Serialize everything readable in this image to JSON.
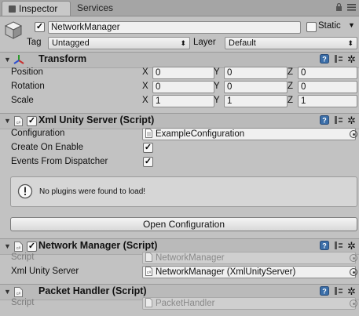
{
  "tabs": [
    {
      "label": "Inspector"
    },
    {
      "label": "Services"
    }
  ],
  "gameobject": {
    "name": "NetworkManager",
    "static_label": "Static",
    "tag_label": "Tag",
    "tag_value": "Untagged",
    "layer_label": "Layer",
    "layer_value": "Default"
  },
  "transform": {
    "title": "Transform",
    "rows": [
      {
        "label": "Position",
        "x": "0",
        "y": "0",
        "z": "0"
      },
      {
        "label": "Rotation",
        "x": "0",
        "y": "0",
        "z": "0"
      },
      {
        "label": "Scale",
        "x": "1",
        "y": "1",
        "z": "1"
      }
    ],
    "axis": {
      "x": "X",
      "y": "Y",
      "z": "Z"
    }
  },
  "xml_server": {
    "title": "Xml Unity Server (Script)",
    "configuration_label": "Configuration",
    "configuration_value": "ExampleConfiguration",
    "create_on_enable_label": "Create On Enable",
    "create_on_enable": true,
    "events_label": "Events From Dispatcher",
    "events_from_dispatcher": true,
    "help_message": "No plugins were found to load!",
    "open_button": "Open Configuration"
  },
  "network_manager": {
    "title": "Network Manager (Script)",
    "script_label": "Script",
    "script_value": "NetworkManager",
    "server_label": "Xml Unity Server",
    "server_value": "NetworkManager (XmlUnityServer)"
  },
  "packet_handler": {
    "title": "Packet Handler (Script)",
    "script_label": "Script",
    "script_value": "PacketHandler"
  },
  "icons": [
    "lock-icon",
    "menu-icon",
    "help-icon",
    "presets-icon",
    "gear-icon",
    "gameobject-cube-icon",
    "transform-axes-icon",
    "script-file-icon",
    "info-icon",
    "object-picker-icon"
  ]
}
